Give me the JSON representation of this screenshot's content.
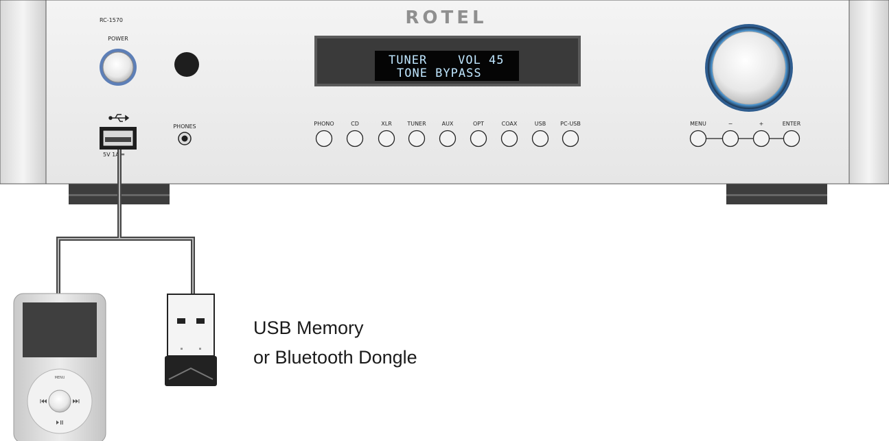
{
  "device": {
    "model": "RC-1570",
    "brand": "ROTEL",
    "power_label": "POWER",
    "phones_label": "PHONES",
    "usb_rating": "5V 1A ═",
    "display": {
      "line1": "TUNER    VOL 45",
      "line2": "TONE BYPASS"
    },
    "inputs": [
      "PHONO",
      "CD",
      "XLR",
      "TUNER",
      "AUX",
      "OPT",
      "COAX",
      "USB",
      "PC-USB"
    ],
    "controls": [
      "MENU",
      "−",
      "+",
      "ENTER"
    ]
  },
  "ipod": {
    "menu_label": "MENU"
  },
  "caption": {
    "line1": "USB Memory",
    "line2": "or Bluetooth Dongle"
  },
  "colors": {
    "panel": "#f0f0f0",
    "display": "#3a3a3a",
    "lcd_text": "#bfe6ff",
    "knob_ring": "#2f6fb0",
    "cable": "#444444"
  }
}
